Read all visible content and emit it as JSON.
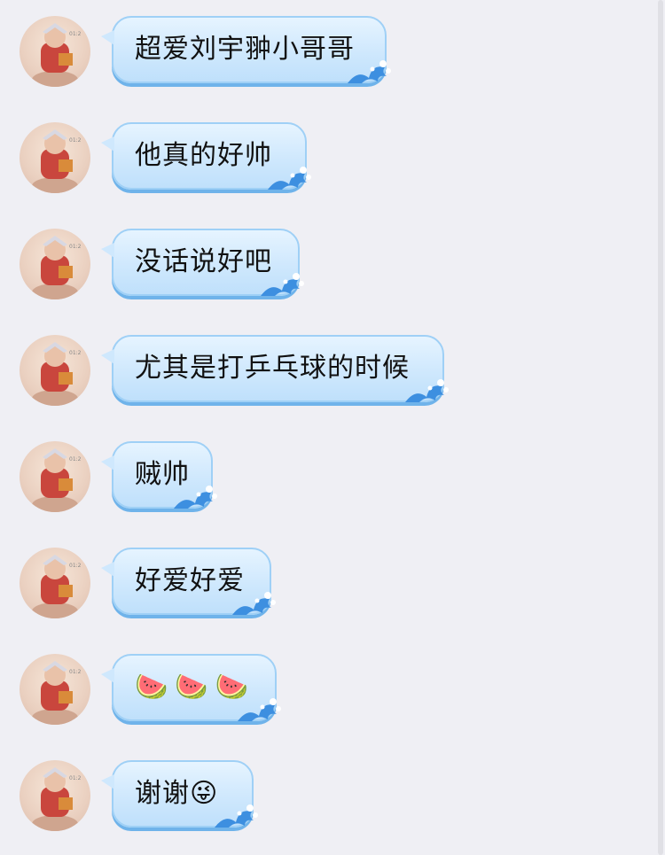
{
  "messages": [
    {
      "text": "超爱刘宇翀小哥哥"
    },
    {
      "text": "他真的好帅"
    },
    {
      "text": "没话说好吧"
    },
    {
      "text": "尤其是打乒乓球的时候"
    },
    {
      "text": "贼帅"
    },
    {
      "text": "好爱好爱"
    },
    {
      "text": "🍉🍉🍉"
    },
    {
      "text": "谢谢😜"
    }
  ],
  "icons": {
    "avatar": "cartoon-avatar-icon",
    "bubble_decoration": "wave-icon"
  },
  "colors": {
    "background": "#efeff4",
    "bubble": "#cfe8fd",
    "bubble_border": "#9fd0f6",
    "wave": "#3d8fe0"
  }
}
